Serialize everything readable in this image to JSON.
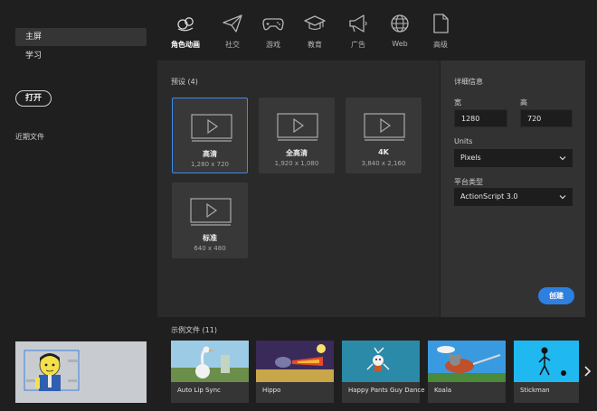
{
  "sidebar": {
    "items": [
      {
        "label": "主屏"
      },
      {
        "label": "学习"
      }
    ],
    "open_label": "打开",
    "recent_label": "近期文件"
  },
  "tabs": [
    {
      "label": "角色动画",
      "icon": "character-animation-icon",
      "active": true
    },
    {
      "label": "社交",
      "icon": "paper-plane-icon"
    },
    {
      "label": "游戏",
      "icon": "gamepad-icon"
    },
    {
      "label": "教育",
      "icon": "graduation-cap-icon"
    },
    {
      "label": "广告",
      "icon": "megaphone-icon"
    },
    {
      "label": "Web",
      "icon": "globe-icon"
    },
    {
      "label": "高级",
      "icon": "document-icon"
    }
  ],
  "presets": {
    "title": "预设 (4)",
    "items": [
      {
        "name": "高清",
        "size": "1,280 x 720"
      },
      {
        "name": "全高清",
        "size": "1,920 x 1,080"
      },
      {
        "name": "4K",
        "size": "3,840 x 2,160"
      },
      {
        "name": "标准",
        "size": "640 x 480"
      }
    ]
  },
  "details": {
    "title": "详细信息",
    "width_label": "宽",
    "width_value": "1280",
    "height_label": "高",
    "height_value": "720",
    "units_label": "Units",
    "units_value": "Pixels",
    "platform_label": "平台类型",
    "platform_value": "ActionScript 3.0",
    "create_label": "创建"
  },
  "examples": {
    "title": "示例文件 (11)",
    "items": [
      {
        "name": "Auto Lip Sync"
      },
      {
        "name": "Hippo"
      },
      {
        "name": "Happy Pants Guy Dance"
      },
      {
        "name": "Koala"
      },
      {
        "name": "Stickman"
      }
    ]
  },
  "colors": {
    "accent": "#2d7fe0",
    "selected_border": "#3d8bf0",
    "background": "#1f1f1f",
    "panel": "#2a2a2a"
  }
}
